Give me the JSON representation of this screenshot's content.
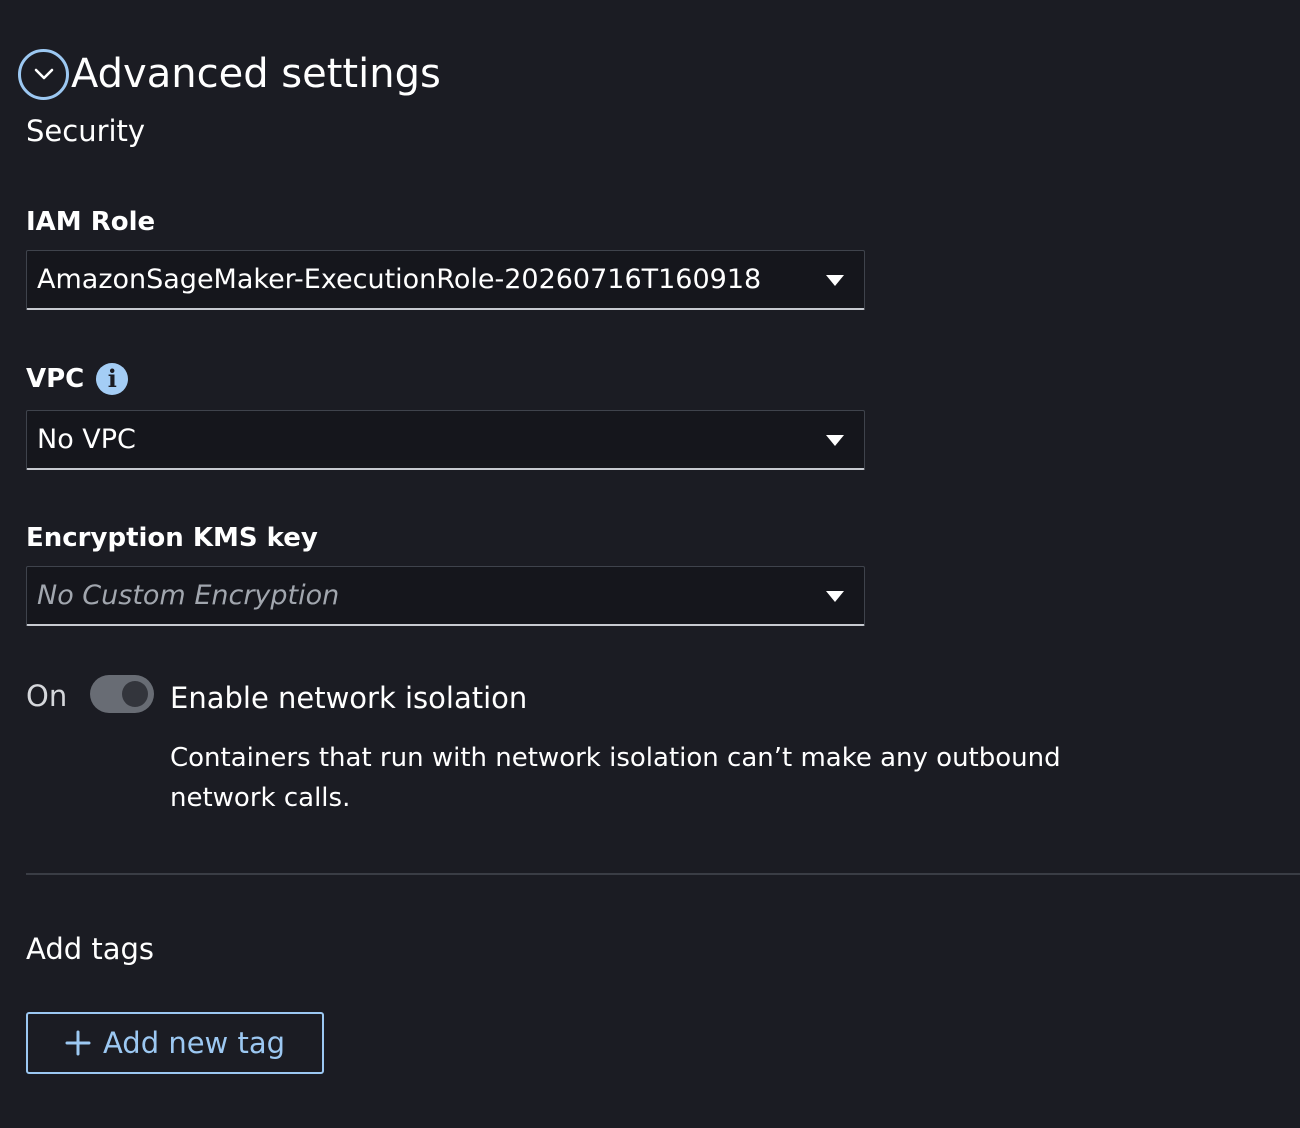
{
  "section": {
    "title": "Advanced settings",
    "expand_icon": "chevron-down-icon"
  },
  "security": {
    "heading": "Security",
    "iam_role": {
      "label": "IAM Role",
      "value": "AmazonSageMaker-ExecutionRole-20260716T160918"
    },
    "vpc": {
      "label": "VPC",
      "info_icon": "info-icon",
      "value": "No VPC"
    },
    "kms": {
      "label": "Encryption KMS key",
      "placeholder": "No Custom Encryption"
    },
    "network_isolation": {
      "state_label": "On",
      "enabled": true,
      "title": "Enable network isolation",
      "description": "Containers that run with network isolation can’t make any outbound network calls."
    }
  },
  "tags": {
    "heading": "Add tags",
    "add_button_label": "Add new tag",
    "add_button_icon": "plus-icon"
  },
  "colors": {
    "background": "#1b1c23",
    "accent": "#9cc8f2",
    "text": "#ffffff"
  }
}
